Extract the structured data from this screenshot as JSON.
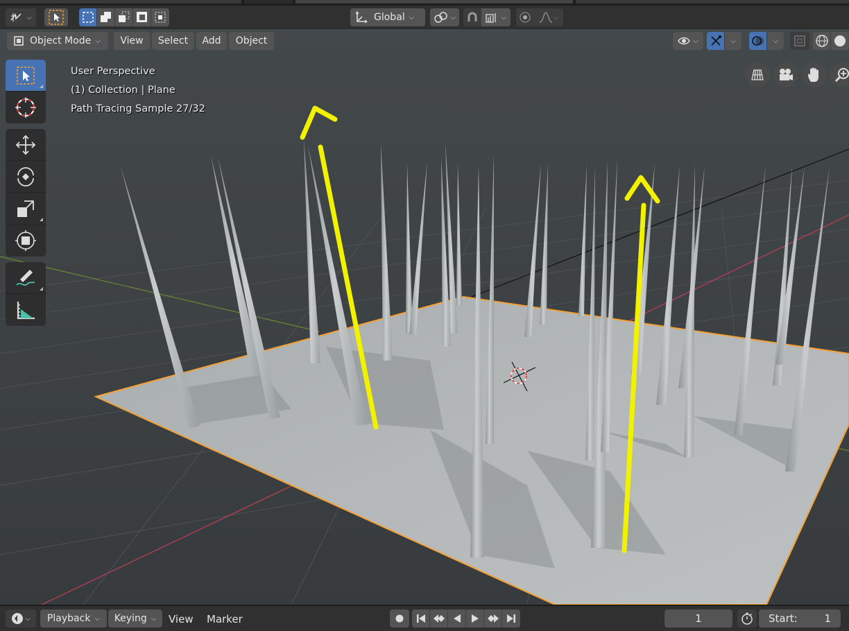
{
  "app": {
    "title": "Blender 3D Viewport"
  },
  "colors": {
    "accent": "#4772b3",
    "selection_outline": "#f5a033",
    "annotation": "#f2f200",
    "x_axis": "#b04050",
    "y_axis": "#6d8a2c",
    "viewport_bg": "#3d3d3d"
  },
  "header": {
    "editor_type_icon": "editor-type-icon",
    "select_tools": [
      "select-box-icon",
      "select-extend-icon",
      "select-subtract-icon",
      "select-invert-icon",
      "select-intersect-icon"
    ],
    "orientation": {
      "label": "Global",
      "icon": "transform-orientation-icon"
    },
    "pivot_icon": "pivot-icon",
    "snap_icon": "snap-magnet-icon",
    "snap_target_icon": "snap-increment-icon",
    "proportional_icon": "proportional-edit-icon",
    "falloff_icon": "falloff-curve-icon"
  },
  "viewport_header": {
    "mode": "Object Mode",
    "menus": [
      "View",
      "Select",
      "Add",
      "Object"
    ],
    "visibility_icon": "eye-icon",
    "gizmo_icon": "gizmo-icon",
    "overlay_icon": "overlay-icon",
    "xray_icon": "xray-icon",
    "shading_icons": [
      "wireframe-icon",
      "solid-shading-icon"
    ]
  },
  "toolbar": {
    "tools": [
      {
        "name": "select-box-tool",
        "icon": "select-cursor-icon",
        "active": true
      },
      {
        "name": "cursor-tool",
        "icon": "cursor-3d-icon",
        "active": false
      },
      {
        "name": "move-tool",
        "icon": "move-icon",
        "active": false
      },
      {
        "name": "rotate-tool",
        "icon": "rotate-icon",
        "active": false
      },
      {
        "name": "scale-tool",
        "icon": "scale-icon",
        "active": false
      },
      {
        "name": "transform-tool",
        "icon": "transform-icon",
        "active": false
      },
      {
        "name": "annotate-tool",
        "icon": "annotate-icon",
        "active": false
      },
      {
        "name": "measure-tool",
        "icon": "measure-icon",
        "active": false
      }
    ]
  },
  "overlay": {
    "perspective": "User Perspective",
    "collection": "(1) Collection | Plane",
    "render_status": "Path Tracing Sample 27/32"
  },
  "nav_gizmo": [
    "ortho-grid-icon",
    "camera-icon",
    "hand-pan-icon",
    "zoom-icon"
  ],
  "timeline": {
    "editor_icon": "timeline-editor-icon",
    "menus": {
      "playback": "Playback",
      "keying": "Keying",
      "view": "View",
      "marker": "Marker"
    },
    "transport_icons": [
      "record-icon",
      "jump-start-icon",
      "prev-keyframe-icon",
      "play-reverse-icon",
      "play-icon",
      "next-keyframe-icon",
      "jump-end-icon"
    ],
    "current_frame": "1",
    "stopwatch_icon": "stopwatch-icon",
    "start_label": "Start:",
    "start_value": "1"
  }
}
